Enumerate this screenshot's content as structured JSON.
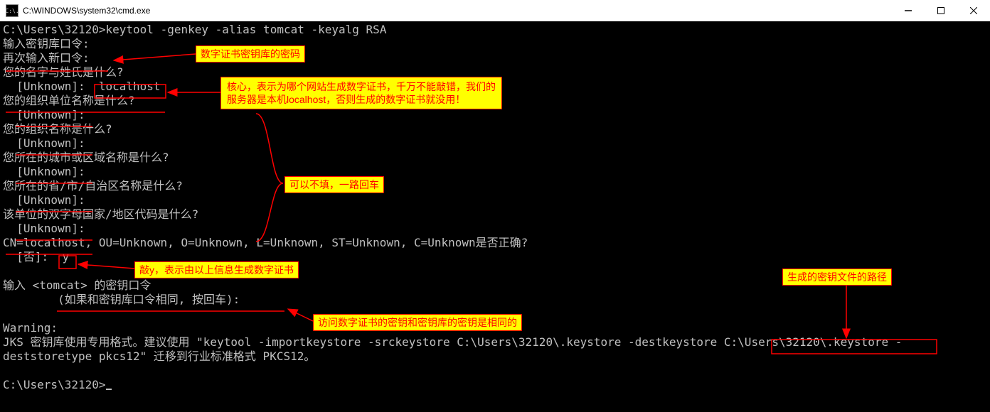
{
  "window": {
    "title": "C:\\WINDOWS\\system32\\cmd.exe",
    "icon_text": "C:\\."
  },
  "term": {
    "l1a": "C:\\Users\\32120>",
    "l1b": "keytool -genkey -alias tomcat -keyalg RSA",
    "l2": "输入密钥库口令:",
    "l3": "再次输入新口令:",
    "l4": "您的名字与姓氏是什么?",
    "l5a": "  [Unknown]:  ",
    "l5b": "localhost",
    "l6": "您的组织单位名称是什么?",
    "l7": "  [Unknown]:",
    "l8": "您的组织名称是什么?",
    "l9": "  [Unknown]:",
    "l10": "您所在的城市或区域名称是什么?",
    "l11": "  [Unknown]:",
    "l12": "您所在的省/市/自治区名称是什么?",
    "l13": "  [Unknown]:",
    "l14": "该单位的双字母国家/地区代码是什么?",
    "l15": "  [Unknown]:",
    "l16": "CN=localhost, OU=Unknown, O=Unknown, L=Unknown, ST=Unknown, C=Unknown是否正确?",
    "l17a": "  [否]:  ",
    "l17b": "y",
    "l18": "",
    "l19": "输入 <tomcat> 的密钥口令",
    "l20": "        (如果和密钥库口令相同, 按回车):",
    "l21": "",
    "l22": "Warning:",
    "l23a": "JKS 密钥库使用专用格式。建议使用 \"keytool -importkeystore -srckeystore C:\\Users\\32120\\.keystore -destkeystore ",
    "l23b": "C:\\Users\\32120\\.keystore",
    "l23c": " -",
    "l24": "deststoretype pkcs12\" 迁移到行业标准格式 PKCS12。",
    "l25": "",
    "l26a": "C:\\Users\\32120>"
  },
  "annotations": {
    "a1": "数字证书密钥库的密码",
    "a2_line1": "核心，表示为哪个网站生成数字证书，千万不能敲错，我们的",
    "a2_line2": "服务器是本机localhost，否则生成的数字证书就没用！",
    "a3": "可以不填，一路回车",
    "a4": "敲y，表示由以上信息生成数字证书",
    "a5": "访问数字证书的密钥和密钥库的密钥是相同的",
    "a6": "生成的密钥文件的路径"
  }
}
